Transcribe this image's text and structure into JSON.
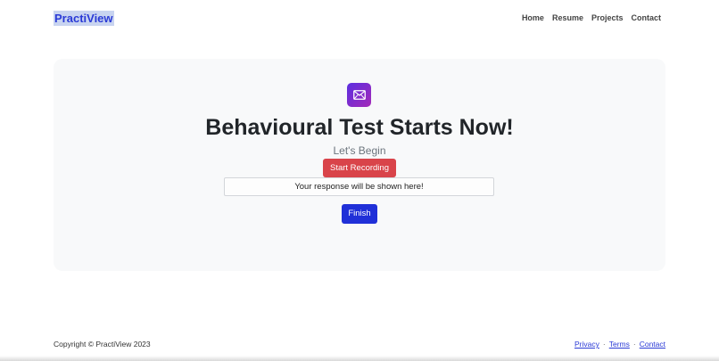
{
  "header": {
    "brand": "PractiView",
    "nav": [
      {
        "label": "Home"
      },
      {
        "label": "Resume"
      },
      {
        "label": "Projects"
      },
      {
        "label": "Contact"
      }
    ]
  },
  "main": {
    "icon": "envelope-icon",
    "title": "Behavioural Test Starts Now!",
    "subtitle": "Let's Begin",
    "record_button": "Start Recording",
    "response_text": "Your response will be shown here!",
    "finish_button": "Finish"
  },
  "footer": {
    "copyright": "Copyright © PractiView 2023",
    "links": [
      {
        "label": "Privacy"
      },
      {
        "label": "Terms"
      },
      {
        "label": "Contact"
      }
    ],
    "separator": "·"
  },
  "colors": {
    "brand": "#2a3ad6",
    "record": "#d9444a",
    "finish": "#2030d8",
    "card": "#f8f9fa"
  }
}
